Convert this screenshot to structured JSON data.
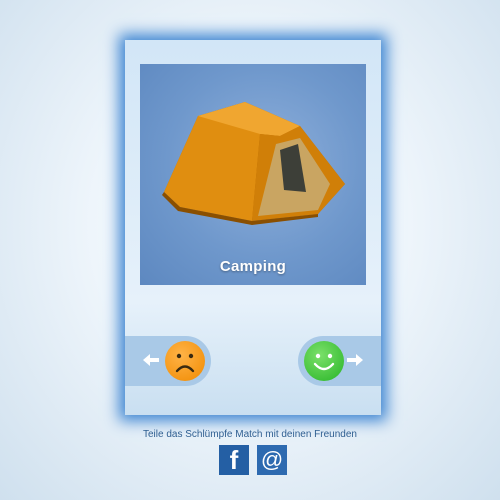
{
  "card": {
    "caption": "Camping"
  },
  "actions": {
    "dislike_arrow": "←",
    "like_arrow": "→"
  },
  "footer": {
    "share_text": "Teile das Schlümpfe Match mit deinen Freunden",
    "facebook_label": "f",
    "email_label": "@"
  },
  "colors": {
    "card_glow": "#3f86d2",
    "dislike_face": "#f08a00",
    "like_face": "#27b426",
    "social_bg": "#245fa4"
  },
  "icons": [
    "tent-image",
    "left-arrow-icon",
    "sad-face-icon",
    "happy-face-icon",
    "right-arrow-icon",
    "facebook-icon",
    "email-icon"
  ]
}
